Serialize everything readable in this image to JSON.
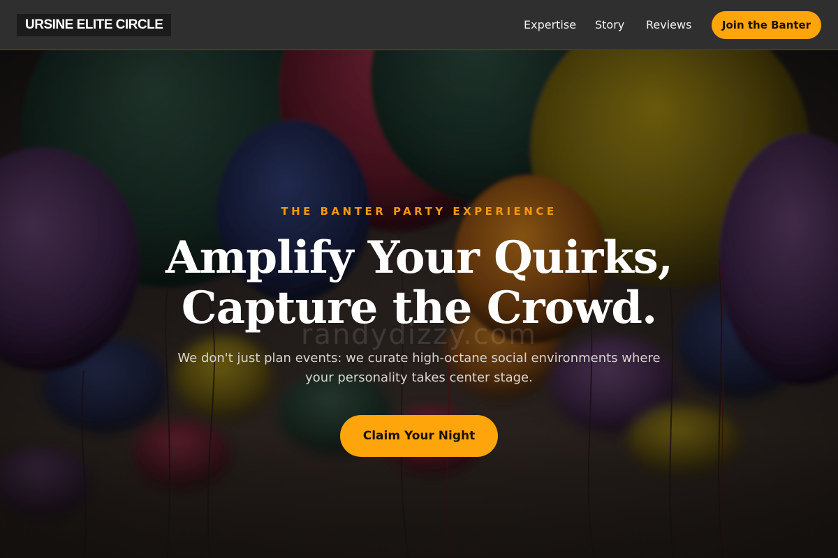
{
  "header": {
    "logo": "URSINE ELITE CIRCLE",
    "nav": [
      "Expertise",
      "Story",
      "Reviews"
    ],
    "cta_label": "Join the Banter"
  },
  "hero": {
    "eyebrow": "THE BANTER PARTY EXPERIENCE",
    "headline_line1": "Amplify Your Quirks,",
    "headline_line2": "Capture the Crowd.",
    "watermark": "randydizzy.com",
    "subtext": "We don't just plan events: we curate high-octane social environments where your personality takes center stage.",
    "cta_label": "Claim Your Night",
    "background": "balloons-photo"
  },
  "colors": {
    "accent": "#ffa50c",
    "eyebrow": "#f29a0e",
    "header_bg": "#2f2f2f"
  }
}
